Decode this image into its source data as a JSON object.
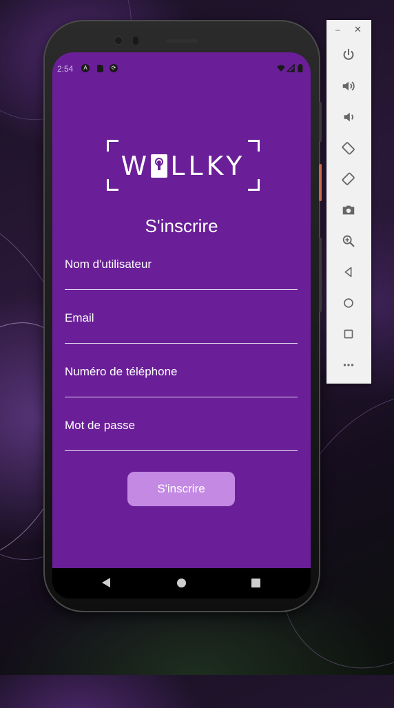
{
  "status_bar": {
    "time": "2:54"
  },
  "app": {
    "logo_text_left": "W",
    "logo_text_right": "LLKY",
    "title": "S'inscrire",
    "fields": [
      {
        "label": "Nom d'utilisateur",
        "value": ""
      },
      {
        "label": "Email",
        "value": ""
      },
      {
        "label": "Numéro de téléphone",
        "value": ""
      },
      {
        "label": "Mot de passe",
        "value": ""
      }
    ],
    "submit_label": "S'inscrire",
    "colors": {
      "background": "#6a1f98",
      "button": "#c389e3",
      "text": "#ffffff"
    }
  },
  "emulator_panel": {
    "window_controls": [
      "minimize-icon",
      "close-icon"
    ],
    "buttons": [
      "power-icon",
      "volume-up-icon",
      "volume-down-icon",
      "rotate-left-icon",
      "rotate-right-icon",
      "camera-icon",
      "zoom-icon",
      "back-icon",
      "home-icon",
      "overview-icon",
      "more-icon"
    ]
  },
  "nav_bar": {
    "buttons": [
      "back-icon",
      "home-icon",
      "recents-icon"
    ]
  }
}
